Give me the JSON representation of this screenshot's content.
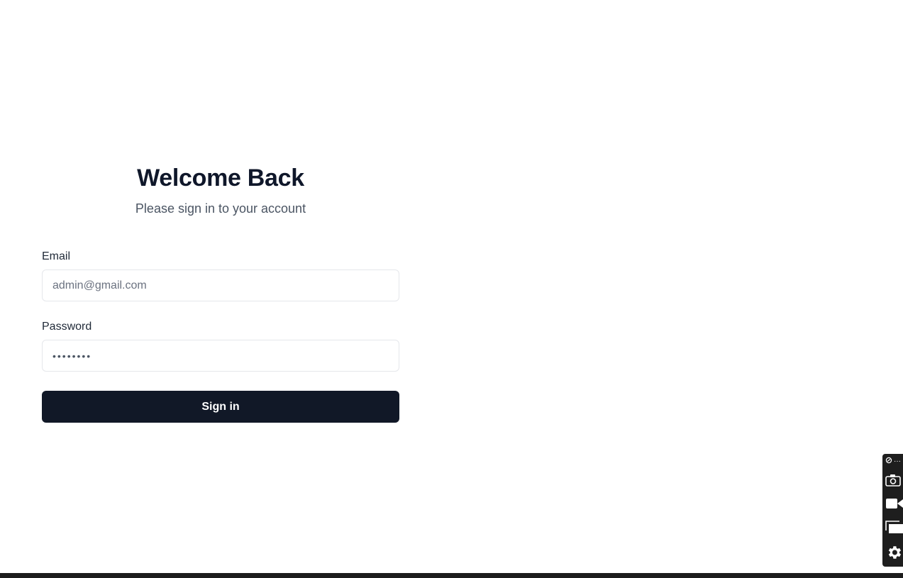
{
  "login": {
    "title": "Welcome Back",
    "subtitle": "Please sign in to your account",
    "email_label": "Email",
    "email_placeholder": "admin@gmail.com",
    "password_label": "Password",
    "password_masked": "••••••••",
    "signin_label": "Sign in"
  },
  "toolbar": {
    "icons": [
      "extension-icon",
      "more-icon",
      "camera-icon",
      "video-icon",
      "window-icon",
      "gear-icon"
    ],
    "more_glyph": "···"
  },
  "colors": {
    "button_bg": "#111827",
    "title": "#0f172a",
    "toolbar_bg": "#1e1e1e"
  }
}
